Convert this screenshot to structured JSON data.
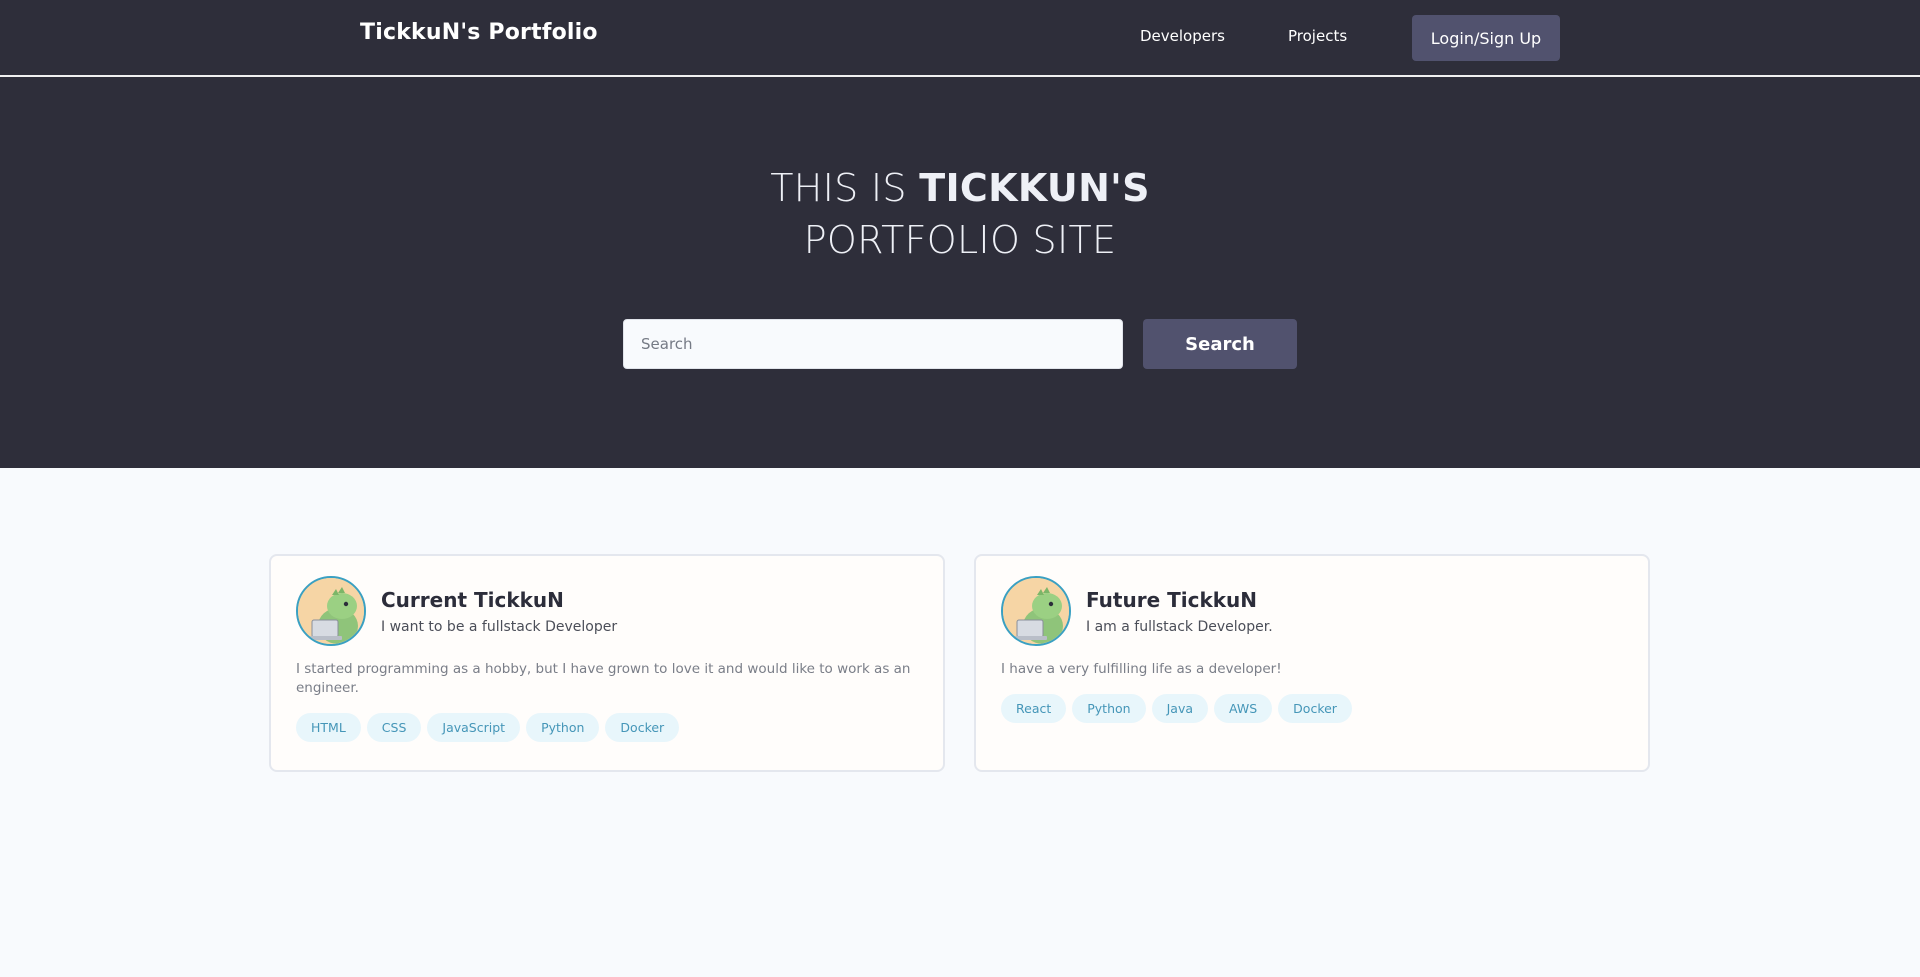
{
  "navbar": {
    "brand": "TickkuN's Portfolio",
    "links": [
      {
        "label": "Developers"
      },
      {
        "label": "Projects"
      }
    ],
    "login_label": "Login/Sign Up"
  },
  "hero": {
    "title_prefix": "THIS IS ",
    "title_bold": "TICKKUN'S",
    "title_line2": "PORTFOLIO SITE",
    "search_placeholder": "Search",
    "search_button": "Search"
  },
  "cards": [
    {
      "name": "Current TickkuN",
      "tagline": "I want to be a fullstack Developer",
      "description": "I started programming as a hobby, but I have grown to love it and would like to work as an engineer.",
      "tags": [
        "HTML",
        "CSS",
        "JavaScript",
        "Python",
        "Docker"
      ]
    },
    {
      "name": "Future TickkuN",
      "tagline": "I am a fullstack Developer.",
      "description": "I have a very fulfilling life as a developer!",
      "tags": [
        "React",
        "Python",
        "Java",
        "AWS",
        "Docker"
      ]
    }
  ],
  "colors": {
    "header_bg": "#2e2e3a",
    "button_bg": "#51526e",
    "page_bg": "#f8fafd",
    "tag_bg": "#e8f6fb",
    "tag_text": "#4596b8",
    "avatar_ring": "#3aa0c2"
  },
  "icons": {
    "avatar": "dinosaur-with-laptop-icon"
  }
}
